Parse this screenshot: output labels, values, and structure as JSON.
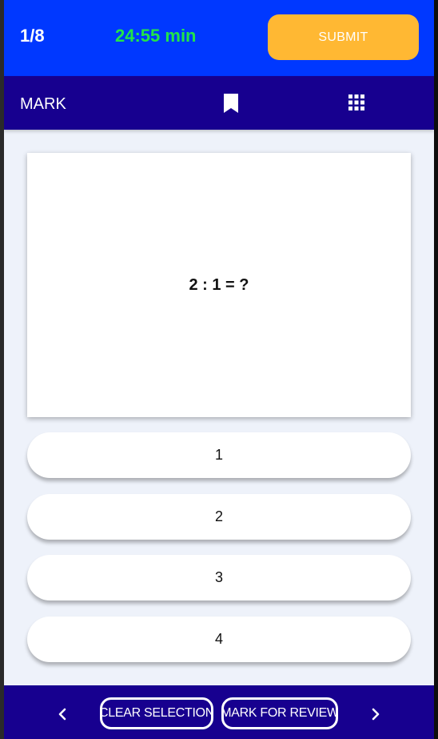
{
  "header": {
    "counter": "1/8",
    "timer": "24:55 min",
    "submit_label": "SUBMIT"
  },
  "toolbar": {
    "mark_label": "MARK",
    "bookmark_icon": "bookmark-icon",
    "grid_icon": "grid-icon"
  },
  "question": {
    "text": "2 : 1 = ?"
  },
  "options": [
    {
      "label": "1"
    },
    {
      "label": "2"
    },
    {
      "label": "3"
    },
    {
      "label": "4"
    }
  ],
  "footer": {
    "prev_icon": "chevron-left-icon",
    "clear_label": "CLEAR SELECTION",
    "review_label": "MARK FOR REVIEW",
    "next_icon": "chevron-right-icon"
  },
  "colors": {
    "header_bg": "#0038ff",
    "toolbar_bg": "#17008f",
    "timer": "#22e34a",
    "submit_bg": "#ffb833",
    "page_bg": "#eef2fa"
  }
}
